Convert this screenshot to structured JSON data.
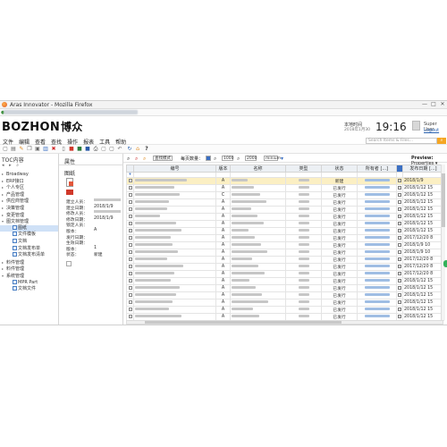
{
  "window": {
    "title": "Aras Innovator - Mozilla Firefox",
    "minimize": "—",
    "maximize": "□",
    "close": "✕"
  },
  "header": {
    "logo_latin": "BOZHON",
    "logo_cn": "博众",
    "date_label": "本地时间",
    "date_value": "2018年1月30",
    "clock": "19:16",
    "user": "Super User",
    "logout": "Logout"
  },
  "menu": [
    "文件",
    "编辑",
    "查看",
    "查找",
    "操作",
    "报表",
    "工具",
    "帮助"
  ],
  "search": {
    "placeholder": "Search Items & Files...",
    "button": "⌕"
  },
  "sidebar": {
    "title": "TOC内容",
    "tools": "◂ ▸ ⌕",
    "items": [
      {
        "label": "Broadway",
        "indent": 0,
        "expand": "▸"
      },
      {
        "label": "ERP接口",
        "indent": 0,
        "expand": "▸"
      },
      {
        "label": "个人专区",
        "indent": 0,
        "expand": "▸"
      },
      {
        "label": "产品管理",
        "indent": 0,
        "expand": "▸"
      },
      {
        "label": "供应商管理",
        "indent": 0,
        "expand": "▸"
      },
      {
        "label": "决策管理",
        "indent": 0,
        "expand": "▸"
      },
      {
        "label": "变更管理",
        "indent": 0,
        "expand": "▸"
      },
      {
        "label": "图文档管理",
        "indent": 0,
        "expand": "▾"
      },
      {
        "label": "图纸",
        "indent": 1,
        "expand": "",
        "selected": true
      },
      {
        "label": "文件模板",
        "indent": 1,
        "expand": ""
      },
      {
        "label": "文档",
        "indent": 1,
        "expand": ""
      },
      {
        "label": "文档发布单",
        "indent": 1,
        "expand": ""
      },
      {
        "label": "文档发布清单",
        "indent": 1,
        "expand": ""
      },
      {
        "label": "料件管理",
        "indent": 0,
        "expand": "▸"
      },
      {
        "label": "料件管理",
        "indent": 0,
        "expand": "▸"
      },
      {
        "label": "系统管理",
        "indent": 0,
        "expand": "▾"
      },
      {
        "label": "MPR Part",
        "indent": 1,
        "expand": ""
      },
      {
        "label": "文档文件",
        "indent": 1,
        "expand": ""
      }
    ]
  },
  "properties": {
    "panel_title": "属性",
    "item_name": "图纸",
    "rows": [
      {
        "label": "建立人员：",
        "value": ""
      },
      {
        "label": "建立日期：",
        "value": "2018/1/9"
      },
      {
        "label": "修改人员：",
        "value": ""
      },
      {
        "label": "修改日期：",
        "value": "2018/1/9"
      },
      {
        "label": "锁定人员：",
        "value": ""
      },
      {
        "label": "版本：",
        "value": "A"
      },
      {
        "label": "发行日期：",
        "value": ""
      },
      {
        "label": "生效日期：",
        "value": ""
      },
      {
        "label": "版本：",
        "value": "1"
      },
      {
        "label": "状态：",
        "value": "新建"
      }
    ]
  },
  "grid_toolbar": {
    "search_type_label": "查找模式",
    "page_size_label": "每页数量：",
    "page_size": "1000",
    "max_results": "2000",
    "mode": "minium",
    "preview_label": "Preview:",
    "preview_value": "Properties"
  },
  "grid": {
    "columns": [
      "",
      "编号",
      "版本",
      "名称",
      "类型",
      "状态",
      "所有者 [...]",
      "",
      "发布日期 [...]"
    ],
    "rows": [
      {
        "rev": "A",
        "status": "新建",
        "date": "2018/1/9",
        "selected": true
      },
      {
        "rev": "A",
        "status": "已发行",
        "date": "2018/1/12 15"
      },
      {
        "rev": "C",
        "status": "已发行",
        "date": "2018/1/12 15"
      },
      {
        "rev": "A",
        "status": "已发行",
        "date": "2018/1/12 15"
      },
      {
        "rev": "A",
        "status": "已发行",
        "date": "2018/1/12 15"
      },
      {
        "rev": "A",
        "status": "已发行",
        "date": "2018/1/12 15"
      },
      {
        "rev": "A",
        "status": "已发行",
        "date": "2018/1/12 15"
      },
      {
        "rev": "A",
        "status": "已发行",
        "date": "2018/1/12 15"
      },
      {
        "rev": "A",
        "status": "已发行",
        "date": "2017/12/20 8"
      },
      {
        "rev": "A",
        "status": "已发行",
        "date": "2018/1/9 10"
      },
      {
        "rev": "A",
        "status": "已发行",
        "date": "2018/1/9 10"
      },
      {
        "rev": "A",
        "status": "已发行",
        "date": "2017/12/20 8"
      },
      {
        "rev": "A",
        "status": "已发行",
        "date": "2017/12/20 8"
      },
      {
        "rev": "A",
        "status": "已发行",
        "date": "2017/12/20 8"
      },
      {
        "rev": "A",
        "status": "已发行",
        "date": "2018/1/12 15"
      },
      {
        "rev": "A",
        "status": "已发行",
        "date": "2018/1/12 15"
      },
      {
        "rev": "A",
        "status": "已发行",
        "date": "2018/1/12 15"
      },
      {
        "rev": "A",
        "status": "已发行",
        "date": "2018/1/12 15"
      },
      {
        "rev": "A",
        "status": "已发行",
        "date": "2018/1/12 15"
      },
      {
        "rev": "A",
        "status": "已发行",
        "date": "2018/1/12 15"
      }
    ]
  }
}
